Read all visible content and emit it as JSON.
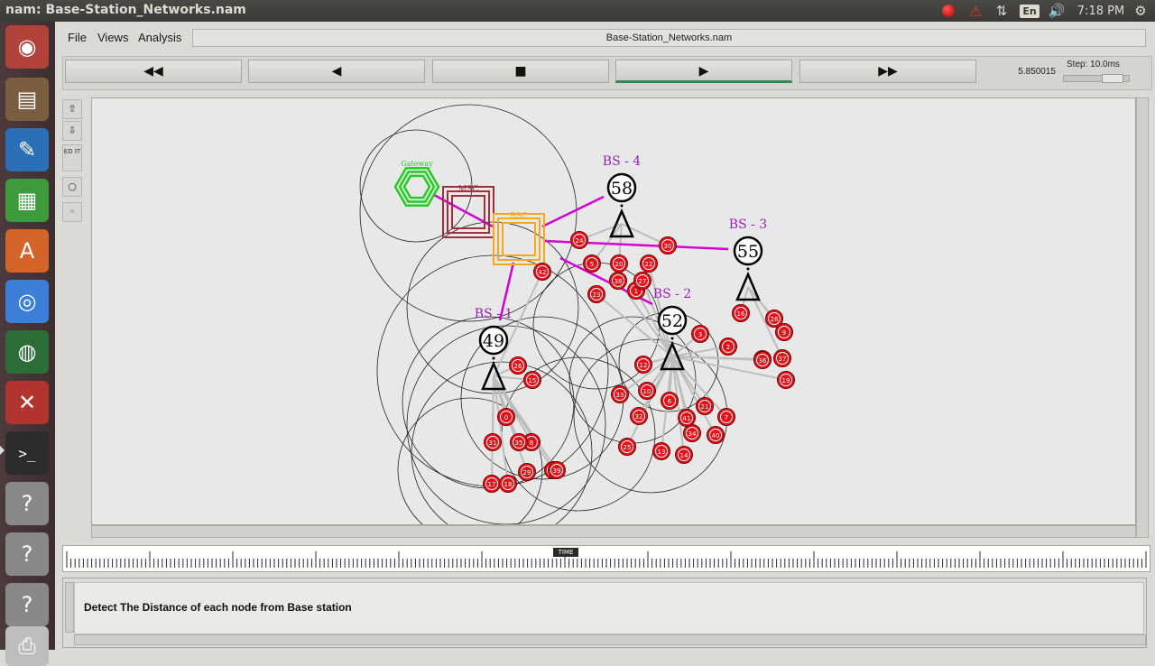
{
  "window": {
    "title": "nam: Base-Station_Networks.nam"
  },
  "tray": {
    "lang": "En",
    "time": "7:18 PM"
  },
  "menu": {
    "file": "File",
    "views": "Views",
    "analysis": "Analysis"
  },
  "file_title": "Base-Station_Networks.nam",
  "controls": {
    "rewind": "◀◀",
    "back": "◀",
    "stop": "■",
    "play": "▶",
    "fast_forward": "▶▶",
    "time_value": "5.850015",
    "step_label": "Step: 10.0ms"
  },
  "side_buttons": {
    "edit": "ED IT"
  },
  "canvas": {
    "labels": {
      "gateway": "Gateway",
      "msc": "MSC",
      "bsc": "BSC",
      "bs1": "BS - 1",
      "bs2": "BS - 2",
      "bs3": "BS - 3",
      "bs4": "BS - 4"
    },
    "base_stations": [
      "49",
      "52",
      "55",
      "58"
    ],
    "nodes": [
      "0",
      "1",
      "2",
      "3",
      "4",
      "5",
      "6",
      "7",
      "8",
      "9",
      "10",
      "11",
      "12",
      "13",
      "14",
      "15",
      "16",
      "17",
      "18",
      "19",
      "20",
      "21",
      "22",
      "23",
      "24",
      "25",
      "26",
      "27",
      "28",
      "29",
      "30",
      "31",
      "32",
      "33",
      "34",
      "35",
      "36",
      "37",
      "38",
      "39",
      "40",
      "41",
      "42"
    ],
    "colors": {
      "node_fill": "#e3121b",
      "link_magenta": "#d400d4",
      "gateway_green": "#22cc22",
      "msc_maroon": "#a0303a",
      "bsc_orange": "#f5a623",
      "label_purple": "#9a1fb8"
    }
  },
  "timeline": {
    "marker": "TIME"
  },
  "annotation": {
    "text": "Detect The Distance of each node from Base station"
  }
}
